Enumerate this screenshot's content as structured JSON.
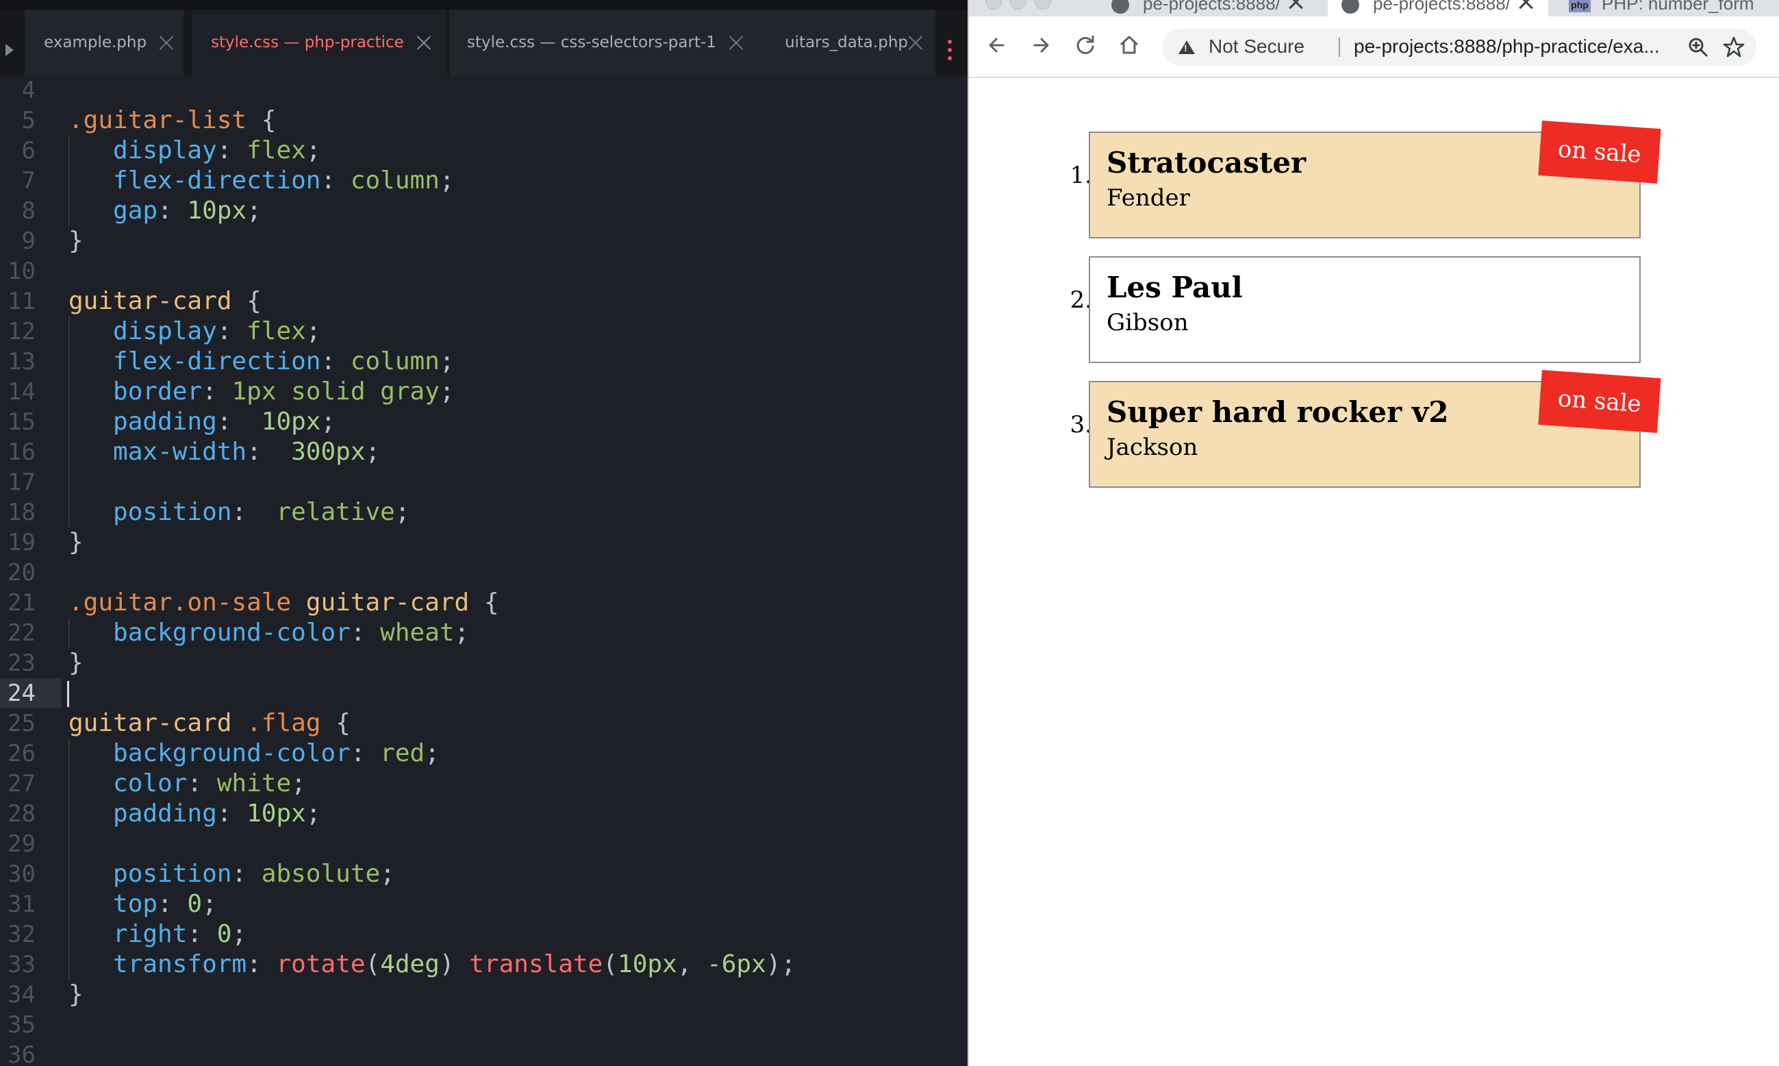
{
  "editor": {
    "tabs": [
      {
        "label": "example.php",
        "active": false
      },
      {
        "label": "style.css — php-practice",
        "active": true
      },
      {
        "label": "style.css — css-selectors-part-1",
        "active": false
      },
      {
        "label": "uitars_data.php",
        "active": false
      }
    ],
    "current_line": "24",
    "lines": [
      {
        "n": "4",
        "tokens": []
      },
      {
        "n": "5",
        "tokens": [
          {
            "t": ".guitar-list",
            "c": "sel"
          },
          {
            "t": " {",
            "c": "pun"
          }
        ]
      },
      {
        "n": "6",
        "tokens": [
          {
            "t": "   display",
            "c": "prop"
          },
          {
            "t": ": ",
            "c": "pun"
          },
          {
            "t": "flex",
            "c": "val"
          },
          {
            "t": ";",
            "c": "pun"
          }
        ]
      },
      {
        "n": "7",
        "tokens": [
          {
            "t": "   flex-direction",
            "c": "prop"
          },
          {
            "t": ": ",
            "c": "pun"
          },
          {
            "t": "column",
            "c": "val"
          },
          {
            "t": ";",
            "c": "pun"
          }
        ]
      },
      {
        "n": "8",
        "tokens": [
          {
            "t": "   gap",
            "c": "prop"
          },
          {
            "t": ": ",
            "c": "pun"
          },
          {
            "t": "10px",
            "c": "num"
          },
          {
            "t": ";",
            "c": "pun"
          }
        ]
      },
      {
        "n": "9",
        "tokens": [
          {
            "t": "}",
            "c": "pun"
          }
        ]
      },
      {
        "n": "10",
        "tokens": []
      },
      {
        "n": "11",
        "tokens": [
          {
            "t": "guitar-card",
            "c": "el"
          },
          {
            "t": " {",
            "c": "pun"
          }
        ]
      },
      {
        "n": "12",
        "tokens": [
          {
            "t": "   display",
            "c": "prop"
          },
          {
            "t": ": ",
            "c": "pun"
          },
          {
            "t": "flex",
            "c": "val"
          },
          {
            "t": ";",
            "c": "pun"
          }
        ]
      },
      {
        "n": "13",
        "tokens": [
          {
            "t": "   flex-direction",
            "c": "prop"
          },
          {
            "t": ": ",
            "c": "pun"
          },
          {
            "t": "column",
            "c": "val"
          },
          {
            "t": ";",
            "c": "pun"
          }
        ]
      },
      {
        "n": "14",
        "tokens": [
          {
            "t": "   border",
            "c": "prop"
          },
          {
            "t": ": ",
            "c": "pun"
          },
          {
            "t": "1px solid gray",
            "c": "val"
          },
          {
            "t": ";",
            "c": "pun"
          }
        ]
      },
      {
        "n": "15",
        "tokens": [
          {
            "t": "   padding",
            "c": "prop"
          },
          {
            "t": ":  ",
            "c": "pun"
          },
          {
            "t": "10px",
            "c": "num"
          },
          {
            "t": ";",
            "c": "pun"
          }
        ]
      },
      {
        "n": "16",
        "tokens": [
          {
            "t": "   max-width",
            "c": "prop"
          },
          {
            "t": ":  ",
            "c": "pun"
          },
          {
            "t": "300px",
            "c": "num"
          },
          {
            "t": ";",
            "c": "pun"
          }
        ]
      },
      {
        "n": "17",
        "tokens": []
      },
      {
        "n": "18",
        "tokens": [
          {
            "t": "   position",
            "c": "prop"
          },
          {
            "t": ":  ",
            "c": "pun"
          },
          {
            "t": "relative",
            "c": "val"
          },
          {
            "t": ";",
            "c": "pun"
          }
        ]
      },
      {
        "n": "19",
        "tokens": [
          {
            "t": "}",
            "c": "pun"
          }
        ]
      },
      {
        "n": "20",
        "tokens": []
      },
      {
        "n": "21",
        "tokens": [
          {
            "t": ".guitar.on-sale",
            "c": "sel"
          },
          {
            "t": " ",
            "c": "pun"
          },
          {
            "t": "guitar-card",
            "c": "el"
          },
          {
            "t": " {",
            "c": "pun"
          }
        ]
      },
      {
        "n": "22",
        "tokens": [
          {
            "t": "   background-color",
            "c": "prop"
          },
          {
            "t": ": ",
            "c": "pun"
          },
          {
            "t": "wheat",
            "c": "val"
          },
          {
            "t": ";",
            "c": "pun"
          }
        ]
      },
      {
        "n": "23",
        "tokens": [
          {
            "t": "}",
            "c": "pun"
          }
        ]
      },
      {
        "n": "24",
        "tokens": []
      },
      {
        "n": "25",
        "tokens": [
          {
            "t": "guitar-card",
            "c": "el"
          },
          {
            "t": " ",
            "c": "pun"
          },
          {
            "t": ".flag",
            "c": "sel"
          },
          {
            "t": " {",
            "c": "pun"
          }
        ]
      },
      {
        "n": "26",
        "tokens": [
          {
            "t": "   background-color",
            "c": "prop"
          },
          {
            "t": ": ",
            "c": "pun"
          },
          {
            "t": "red",
            "c": "val"
          },
          {
            "t": ";",
            "c": "pun"
          }
        ]
      },
      {
        "n": "27",
        "tokens": [
          {
            "t": "   color",
            "c": "prop"
          },
          {
            "t": ": ",
            "c": "pun"
          },
          {
            "t": "white",
            "c": "val"
          },
          {
            "t": ";",
            "c": "pun"
          }
        ]
      },
      {
        "n": "28",
        "tokens": [
          {
            "t": "   padding",
            "c": "prop"
          },
          {
            "t": ": ",
            "c": "pun"
          },
          {
            "t": "10px",
            "c": "num"
          },
          {
            "t": ";",
            "c": "pun"
          }
        ]
      },
      {
        "n": "29",
        "tokens": []
      },
      {
        "n": "30",
        "tokens": [
          {
            "t": "   position",
            "c": "prop"
          },
          {
            "t": ": ",
            "c": "pun"
          },
          {
            "t": "absolute",
            "c": "val"
          },
          {
            "t": ";",
            "c": "pun"
          }
        ]
      },
      {
        "n": "31",
        "tokens": [
          {
            "t": "   top",
            "c": "prop"
          },
          {
            "t": ": ",
            "c": "pun"
          },
          {
            "t": "0",
            "c": "num"
          },
          {
            "t": ";",
            "c": "pun"
          }
        ]
      },
      {
        "n": "32",
        "tokens": [
          {
            "t": "   right",
            "c": "prop"
          },
          {
            "t": ": ",
            "c": "pun"
          },
          {
            "t": "0",
            "c": "num"
          },
          {
            "t": ";",
            "c": "pun"
          }
        ]
      },
      {
        "n": "33",
        "tokens": [
          {
            "t": "   transform",
            "c": "prop"
          },
          {
            "t": ": ",
            "c": "pun"
          },
          {
            "t": "rotate",
            "c": "fn"
          },
          {
            "t": "(",
            "c": "pun"
          },
          {
            "t": "4deg",
            "c": "num"
          },
          {
            "t": ") ",
            "c": "pun"
          },
          {
            "t": "translate",
            "c": "fn"
          },
          {
            "t": "(",
            "c": "pun"
          },
          {
            "t": "10px",
            "c": "num"
          },
          {
            "t": ", ",
            "c": "pun"
          },
          {
            "t": "-6px",
            "c": "num"
          },
          {
            "t": ");",
            "c": "pun"
          }
        ]
      },
      {
        "n": "34",
        "tokens": [
          {
            "t": "}",
            "c": "pun"
          }
        ]
      },
      {
        "n": "35",
        "tokens": []
      },
      {
        "n": "36",
        "tokens": []
      }
    ]
  },
  "browser": {
    "tabs": [
      {
        "label": "pe-projects:8888/",
        "icon": "globe-icon",
        "active": false
      },
      {
        "label": "pe-projects:8888/",
        "icon": "globe-icon",
        "active": true
      },
      {
        "label": "PHP: number_form",
        "icon": "php-icon",
        "active": false
      }
    ],
    "security_label": "Not Secure",
    "url": "pe-projects:8888/php-practice/exa...",
    "page": {
      "guitars": [
        {
          "marker": "1.",
          "name": "Stratocaster",
          "maker": "Fender",
          "on_sale": true,
          "flag": "on sale"
        },
        {
          "marker": "2.",
          "name": "Les Paul",
          "maker": "Gibson",
          "on_sale": false,
          "flag": ""
        },
        {
          "marker": "3.",
          "name": "Super hard rocker v2",
          "maker": "Jackson",
          "on_sale": true,
          "flag": "on sale"
        }
      ]
    }
  },
  "colors": {
    "editor_bg": "#1d2026",
    "active_tab_text": "#ff6c6b",
    "wheat": "#f5deb3",
    "flag_red": "#ee2c24"
  }
}
